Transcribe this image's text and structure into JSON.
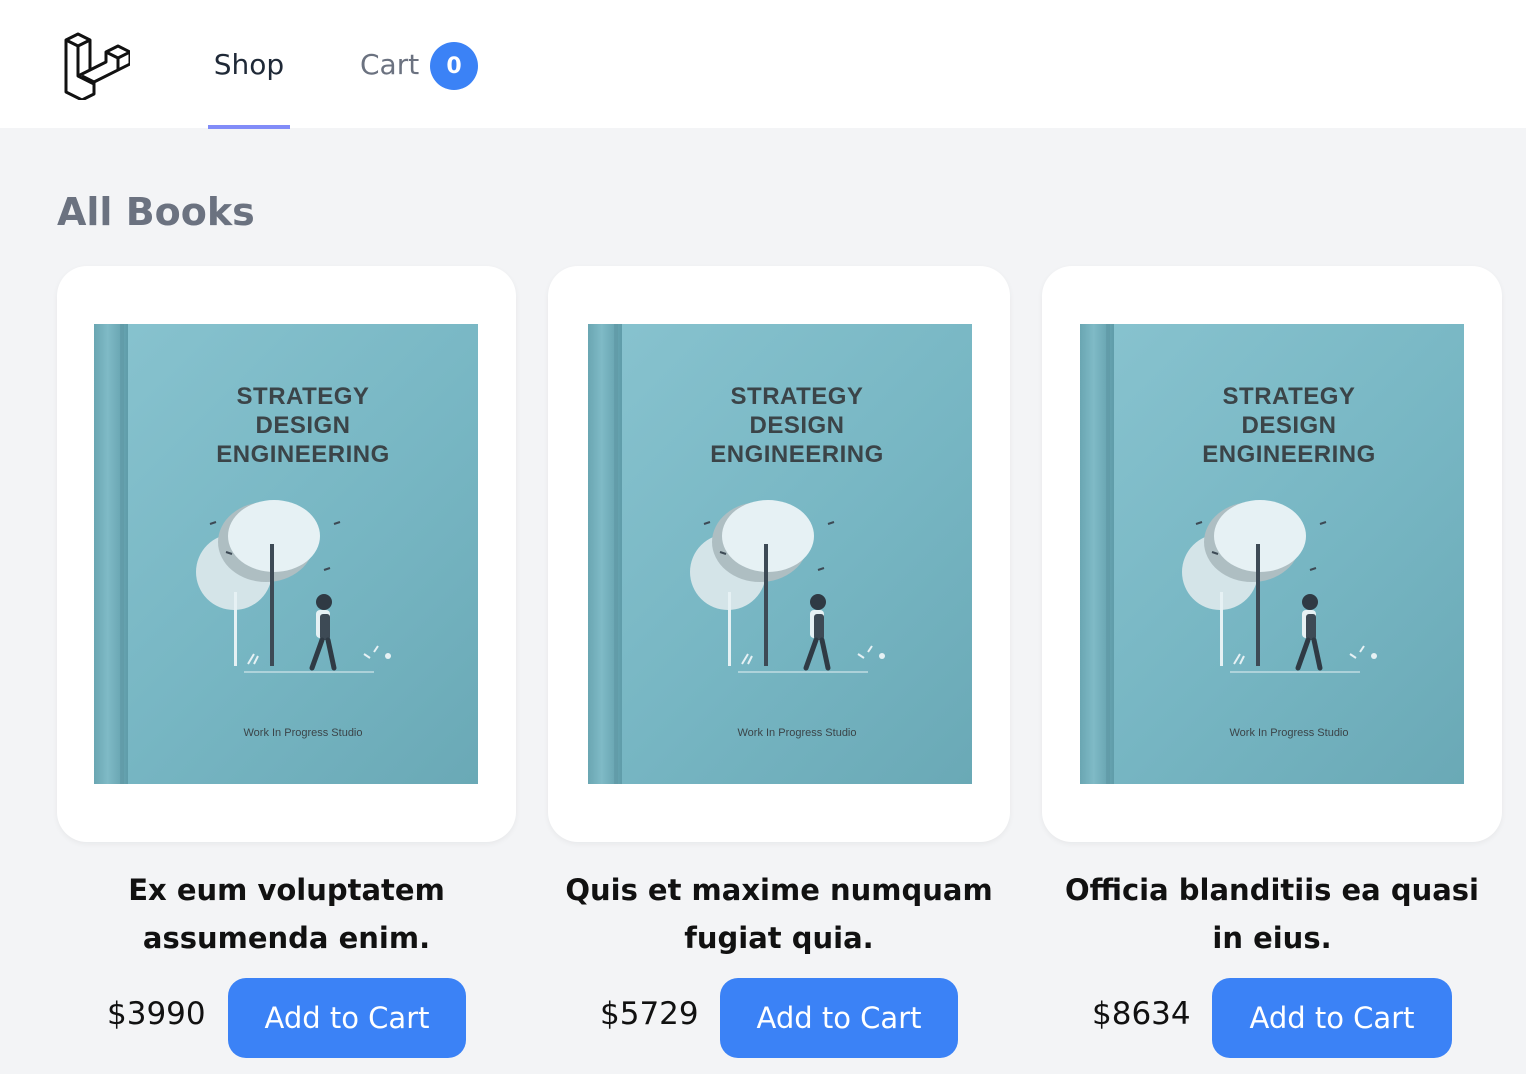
{
  "nav": {
    "shop_label": "Shop",
    "cart_label": "Cart",
    "cart_count": "0",
    "logo_icon": "laravel-logo-icon"
  },
  "page": {
    "heading": "All Books"
  },
  "cover": {
    "title": "STRATEGY\nDESIGN\nENGINEERING",
    "publisher": "Work In Progress Studio"
  },
  "books": [
    {
      "title": "Ex eum voluptatem assumenda enim.",
      "price": "$3990",
      "button": "Add to Cart"
    },
    {
      "title": "Quis et maxime numquam fugiat quia.",
      "price": "$5729",
      "button": "Add to Cart"
    },
    {
      "title": "Officia blanditiis ea quasi in eius.",
      "price": "$8634",
      "button": "Add to Cart"
    }
  ],
  "colors": {
    "accent": "#3b82f6",
    "nav_underline": "#818cf8",
    "background": "#f3f4f6",
    "cover": "#7bbac6"
  }
}
